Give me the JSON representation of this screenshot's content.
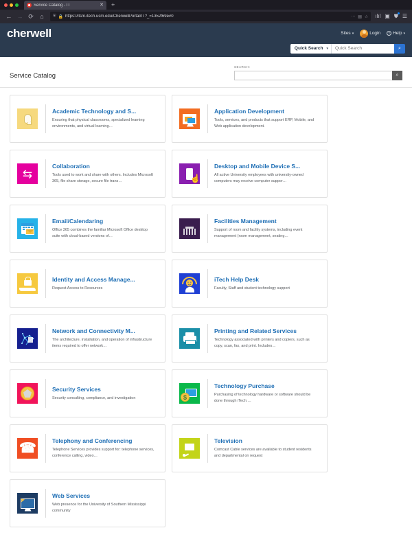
{
  "browser": {
    "tab_title": "Service Catalog - IT",
    "tab_close": "✕",
    "new_tab": "+",
    "url": "https://itsm.itech.usm.edu/CherwellPortal/IT?_=1352f69e#0",
    "back_icon": "←",
    "forward_icon": "→",
    "reload_icon": "⟳",
    "home_icon": "⌂",
    "shield_icon": "⛨",
    "lock_icon": "🔒",
    "ellipsis_icon": "···",
    "reader_icon": "▤",
    "star_icon": "☆",
    "library_icon": "ılıl",
    "sidebar_icon": "▣",
    "account_icon": "⛊",
    "menu_icon": "☰"
  },
  "header": {
    "logo": "cherwell",
    "sites_label": "Sites",
    "login_label": "Login",
    "help_label": "Help",
    "help_glyph": "?",
    "caret": "▾"
  },
  "quick_search": {
    "selector_label": "Quick Search",
    "placeholder": "Quick Search",
    "value": "",
    "search_icon": "⌕",
    "accent_color": "#2c73d2"
  },
  "page": {
    "title": "Service Catalog",
    "search_label": "SEARCH:",
    "search_value": "",
    "search_placeholder": "",
    "search_icon": "⌕"
  },
  "cards": [
    {
      "title": "Academic Technology and S...",
      "desc": "Ensuring that physical classrooms, specialized learning environments, and virtual learning…",
      "icon_name": "lightbulb-icon",
      "bg": "#f6d97e"
    },
    {
      "title": "Application Development",
      "desc": "Tools, services, and products that support ERP, Mobile, and Web application development.",
      "icon_name": "monitor-windows-icon",
      "bg": "#f26c21"
    },
    {
      "title": "Collaboration",
      "desc": "Tools used to work and share with others. Includes Microsoft 365, file share storage, secure file trans…",
      "icon_name": "sharing-hands-icon",
      "bg": "#e5009e"
    },
    {
      "title": "Desktop and Mobile Device S...",
      "desc": "All active University employees with university-owned computers may receive computer suppor…",
      "icon_name": "mobile-device-hand-icon",
      "bg": "#8a1fb0"
    },
    {
      "title": "Email/Calendaring",
      "desc": "Office 365 combines the familiar Microsoft Office desktop suite with cloud-based versions of…",
      "icon_name": "calendar-envelope-icon",
      "bg": "#26b2e8"
    },
    {
      "title": "Facilities Management",
      "desc": "Support of room and facility systems, including event management (room management, seating…",
      "icon_name": "facility-room-icon",
      "bg": "#3a1d4e"
    },
    {
      "title": "Identity and Access Manage...",
      "desc": "Request Access to Resources",
      "icon_name": "lock-hand-icon",
      "bg": "#f6c93f"
    },
    {
      "title": "iTech Help Desk",
      "desc": "Faculty, Staff and student technology support",
      "icon_name": "headset-support-icon",
      "bg": "#1f3fd4"
    },
    {
      "title": "Network and Connectivity M...",
      "desc": "The architecture, installation, and operation of infrastructure items required to offer network…",
      "icon_name": "network-nodes-icon",
      "bg": "#151f8f"
    },
    {
      "title": "Printing and Related Services",
      "desc": "Technology associated with printers and copiers, such as copy, scan, fax, and print. Includes…",
      "icon_name": "printer-icon",
      "bg": "#1b8fa8"
    },
    {
      "title": "Security Services",
      "desc": "Security consulting, compliance, and investigation",
      "icon_name": "security-badge-icon",
      "bg": "#f1145a"
    },
    {
      "title": "Technology Purchase",
      "desc": "Purchasing of technology hardware or software should be done through iTech:…",
      "icon_name": "purchase-coin-monitor-icon",
      "bg": "#0ab84a"
    },
    {
      "title": "Telephony and Conferencing",
      "desc": "Telephone Services provides support for: telephone services, conference calling, video…",
      "icon_name": "telephone-handset-icon",
      "bg": "#f04e23"
    },
    {
      "title": "Television",
      "desc": "Comcast Cable services are available to student residents and departmental on request",
      "icon_name": "television-icon",
      "bg": "#c3d419"
    },
    {
      "title": "Web Services",
      "desc": "Web presence for the University of Southern Mississippi community",
      "icon_name": "web-monitor-cursor-icon",
      "bg": "#1d3c63"
    }
  ]
}
